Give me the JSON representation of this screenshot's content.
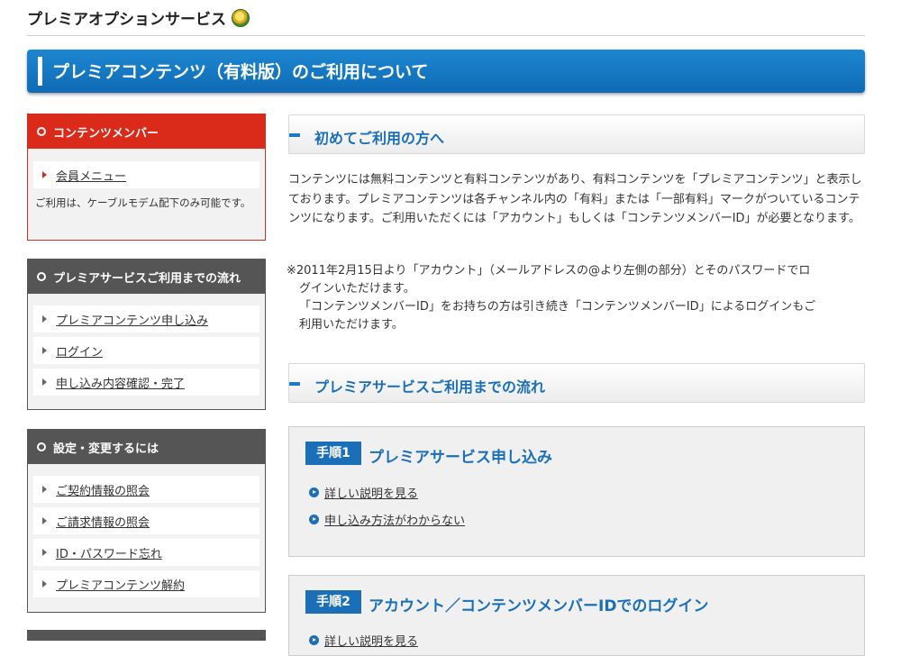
{
  "header": {
    "title": "プレミアオプションサービス",
    "badge_icon": "award-badge-icon"
  },
  "banner": {
    "title": "プレミアコンテンツ（有料版）のご利用について"
  },
  "sidebar": {
    "member_box": {
      "title": "コンテンツメンバー",
      "items": [
        {
          "label": "会員メニュー"
        }
      ],
      "note": "ご利用は、ケーブルモデム配下のみ可能です。"
    },
    "flow_box": {
      "title": "プレミアサービスご利用までの流れ",
      "items": [
        {
          "label": "プレミアコンテンツ申し込み"
        },
        {
          "label": "ログイン"
        },
        {
          "label": "申し込み内容確認・完了"
        }
      ]
    },
    "settings_box": {
      "title": "設定・変更するには",
      "items": [
        {
          "label": "ご契約情報の照会"
        },
        {
          "label": "ご請求情報の照会"
        },
        {
          "label": "ID・パスワード忘れ"
        },
        {
          "label": "プレミアコンテンツ解約"
        }
      ]
    }
  },
  "main": {
    "section1": {
      "title": "初めてご利用の方へ",
      "paragraph": "コンテンツには無料コンテンツと有料コンテンツがあり、有料コンテンツを「プレミアコンテンツ」と表示しております。プレミアコンテンツは各チャンネル内の「有料」または「一部有料」マークがついているコンテンツになります。ご利用いただくには「アカウント」もしくは「コンテンツメンバーID」が必要となります。",
      "note_line1": "※2011年2月15日より「アカウント」（メールアドレスの@より左側の部分）とそのパスワードでロ",
      "note_line2": "グインいただけます。",
      "note_line3": "「コンテンツメンバーID」をお持ちの方は引き続き「コンテンツメンバーID」によるログインもご",
      "note_line4": "利用いただけます。"
    },
    "section2": {
      "title": "プレミアサービスご利用までの流れ"
    },
    "steps": [
      {
        "chip": "手順1",
        "title": "プレミアサービス申し込み",
        "links": [
          {
            "label": "詳しい説明を見る"
          },
          {
            "label": "申し込み方法がわからない"
          }
        ]
      },
      {
        "chip": "手順2",
        "title": "アカウント／コンテンツメンバーIDでのログイン",
        "links": [
          {
            "label": "詳しい説明を見る"
          }
        ]
      }
    ]
  },
  "colors": {
    "accent_blue": "#1a6fb8",
    "member_red": "#d92a1a",
    "box_gray": "#555555"
  }
}
